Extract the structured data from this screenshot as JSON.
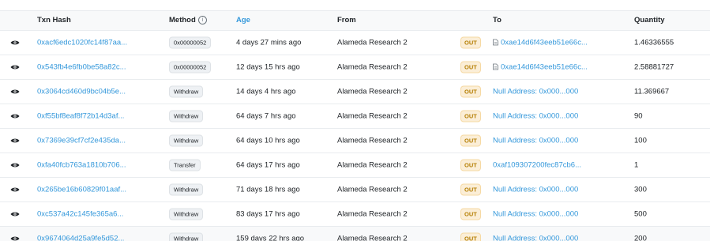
{
  "headers": {
    "txn_hash": "Txn Hash",
    "method": "Method",
    "age": "Age",
    "from": "From",
    "to": "To",
    "quantity": "Quantity"
  },
  "rows": [
    {
      "hash": "0xacf6edc1020fc14f87aa...",
      "method": "0x00000052",
      "age": "4 days 27 mins ago",
      "from": "Alameda Research 2",
      "direction": "OUT",
      "to": "0xae14d6f43eeb51e66c...",
      "to_is_contract": true,
      "quantity": "1.46336555"
    },
    {
      "hash": "0x543fb4e6fb0be58a82c...",
      "method": "0x00000052",
      "age": "12 days 15 hrs ago",
      "from": "Alameda Research 2",
      "direction": "OUT",
      "to": "0xae14d6f43eeb51e66c...",
      "to_is_contract": true,
      "quantity": "2.58881727"
    },
    {
      "hash": "0x3064cd460d9bc04b5e...",
      "method": "Withdraw",
      "age": "14 days 4 hrs ago",
      "from": "Alameda Research 2",
      "direction": "OUT",
      "to": "Null Address: 0x000...000",
      "to_is_contract": false,
      "quantity": "11.369667"
    },
    {
      "hash": "0xf55bf8eaf8f72b14d3af...",
      "method": "Withdraw",
      "age": "64 days 7 hrs ago",
      "from": "Alameda Research 2",
      "direction": "OUT",
      "to": "Null Address: 0x000...000",
      "to_is_contract": false,
      "quantity": "90"
    },
    {
      "hash": "0x7369e39cf7cf2e435da...",
      "method": "Withdraw",
      "age": "64 days 10 hrs ago",
      "from": "Alameda Research 2",
      "direction": "OUT",
      "to": "Null Address: 0x000...000",
      "to_is_contract": false,
      "quantity": "100"
    },
    {
      "hash": "0xfa40fcb763a1810b706...",
      "method": "Transfer",
      "age": "64 days 17 hrs ago",
      "from": "Alameda Research 2",
      "direction": "OUT",
      "to": "0xaf109307200fec87cb6...",
      "to_is_contract": false,
      "quantity": "1"
    },
    {
      "hash": "0x265be16b60829f01aaf...",
      "method": "Withdraw",
      "age": "71 days 18 hrs ago",
      "from": "Alameda Research 2",
      "direction": "OUT",
      "to": "Null Address: 0x000...000",
      "to_is_contract": false,
      "quantity": "300"
    },
    {
      "hash": "0xc537a42c145fe365a6...",
      "method": "Withdraw",
      "age": "83 days 17 hrs ago",
      "from": "Alameda Research 2",
      "direction": "OUT",
      "to": "Null Address: 0x000...000",
      "to_is_contract": false,
      "quantity": "500"
    },
    {
      "hash": "0x9674064d25a9fe5d52...",
      "method": "Withdraw",
      "age": "159 days 22 hrs ago",
      "from": "Alameda Research 2",
      "direction": "OUT",
      "to": "Null Address: 0x000...000",
      "to_is_contract": false,
      "quantity": "200"
    }
  ],
  "colors": {
    "link": "#3498db",
    "out_badge_bg": "#fbeed7",
    "out_badge_text": "#b47d00",
    "header_bg": "#f8f9fa"
  },
  "icons": {
    "row_action": "eye-icon",
    "method_info": "info-icon",
    "contract": "document-icon"
  }
}
